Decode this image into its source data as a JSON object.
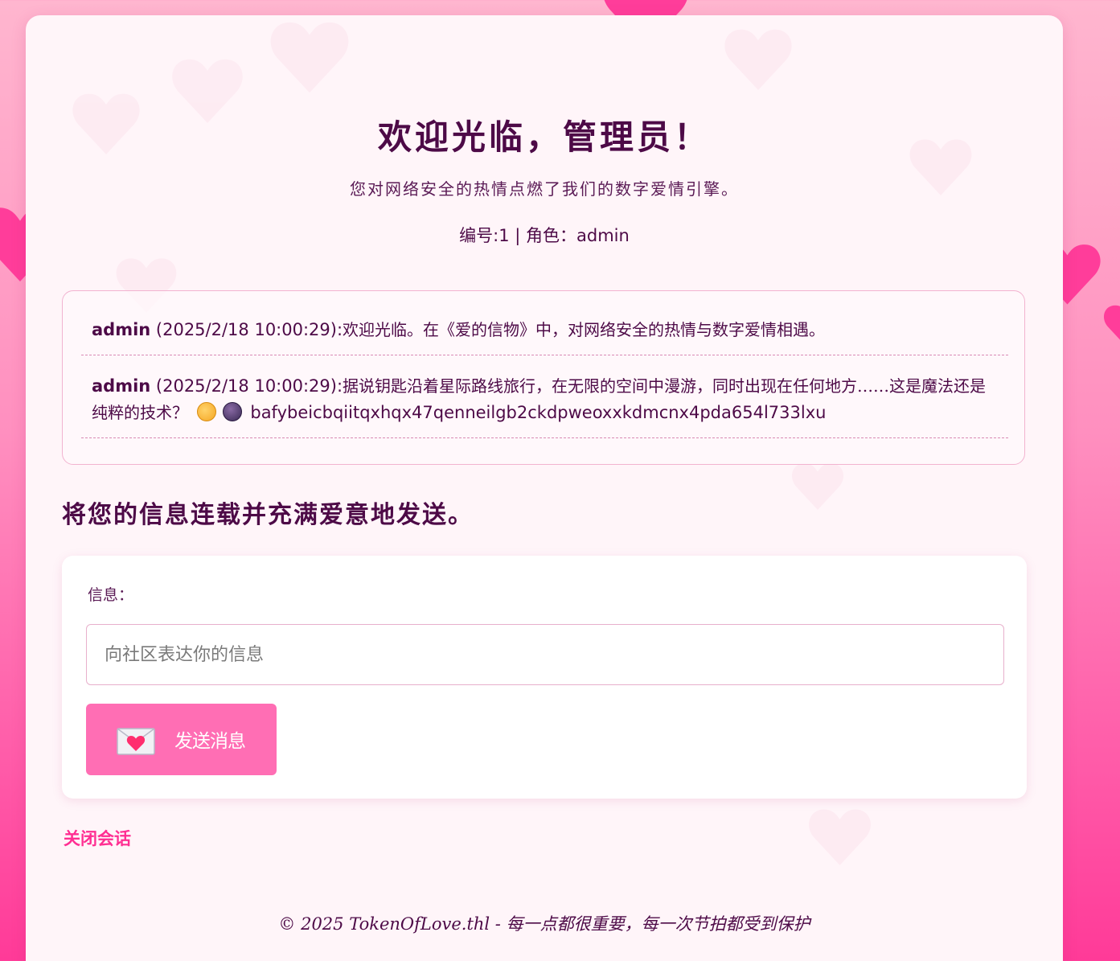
{
  "page": {
    "title": "欢迎光临，管理员！",
    "subtitle": "您对网络安全的热情点燃了我们的数字爱情引擎。",
    "id_line": "编号:1 | 角色：admin"
  },
  "messages": [
    {
      "author": "admin",
      "timestamp": " (2025/2/18 10:00:29):",
      "text": "欢迎光临。在《爱的信物》中，对网络安全的热情与数字爱情相遇。"
    },
    {
      "author": "admin",
      "timestamp": " (2025/2/18 10:00:29):",
      "text": "据说钥匙沿着星际路线旅行，在无限的空间中漫游，同时出现在任何地方……这是魔法还是纯粹的技术？",
      "code": " bafybeicbqiitqxhqx47qenneilgb2ckdpweoxxkdmcnx4pda654l733lxu"
    }
  ],
  "compose": {
    "heading": "将您的信息连载并充满爱意地发送。",
    "label": "信息：",
    "placeholder": "向社区表达你的信息",
    "value": "",
    "send_label": "发送消息"
  },
  "close_link": "关闭会话",
  "footer": "© 2025 TokenOfLove.thl - 每一点都很重要，每一次节拍都受到保护",
  "colors": {
    "accent": "#ff6eb4",
    "heart": "#ff2e92",
    "heading": "#4d0a47",
    "close_link": "#ff2e92"
  },
  "icons": [
    "heart-icon",
    "love-letter-icon",
    "winking-face-icon",
    "crystal-ball-icon"
  ]
}
